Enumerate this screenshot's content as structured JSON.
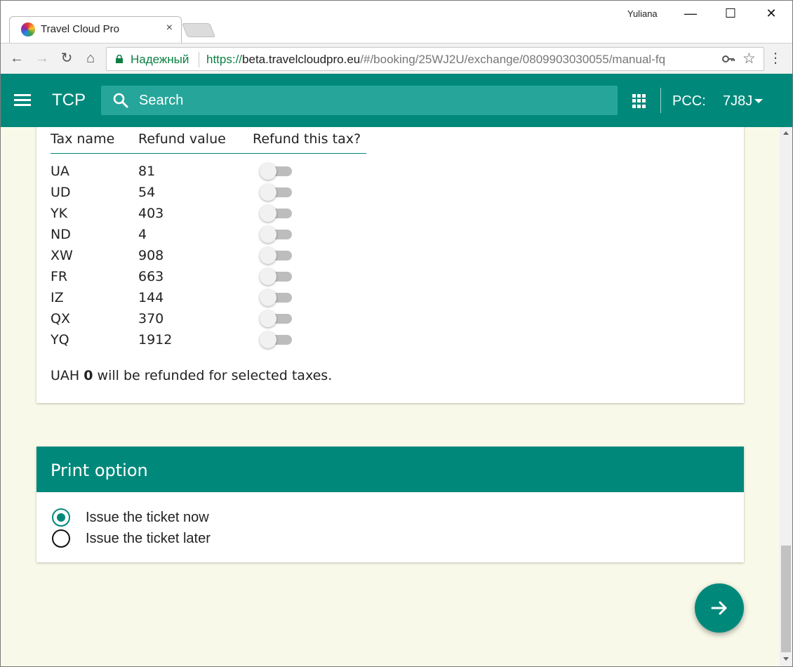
{
  "browser": {
    "tab_title": "Travel Cloud Pro",
    "tab_close": "×",
    "user": "Yuliana",
    "window_controls": {
      "minimize": "—",
      "maximize": "☐",
      "close": "✕"
    },
    "nav": {
      "back": "←",
      "forward": "→",
      "reload": "↻",
      "home": "⌂"
    },
    "secure_label": "Надежный",
    "url_scheme": "https://",
    "url_host": "beta.travelcloudpro.eu",
    "url_path": "/#/booking/25WJ2U/exchange/0809903030055/manual-fq",
    "menu": "⋮"
  },
  "header": {
    "brand": "TCP",
    "search_placeholder": "Search",
    "pcc_label": "PCC:",
    "pcc_value": "7J8J"
  },
  "taxes": {
    "columns": {
      "name": "Tax name",
      "value": "Refund value",
      "refund": "Refund this tax?"
    },
    "rows": [
      {
        "name": "UA",
        "value": "81",
        "refund": false
      },
      {
        "name": "UD",
        "value": "54",
        "refund": false
      },
      {
        "name": "YK",
        "value": "403",
        "refund": false
      },
      {
        "name": "ND",
        "value": "4",
        "refund": false
      },
      {
        "name": "XW",
        "value": "908",
        "refund": false
      },
      {
        "name": "FR",
        "value": "663",
        "refund": false
      },
      {
        "name": "IZ",
        "value": "144",
        "refund": false
      },
      {
        "name": "QX",
        "value": "370",
        "refund": false
      },
      {
        "name": "YQ",
        "value": "1912",
        "refund": false
      }
    ],
    "summary": {
      "currency": "UAH",
      "amount": "0",
      "text": "will be refunded for selected taxes."
    }
  },
  "print_option": {
    "title": "Print option",
    "options": [
      {
        "label": "Issue the ticket now",
        "selected": true
      },
      {
        "label": "Issue the ticket later",
        "selected": false
      }
    ]
  },
  "colors": {
    "primary": "#00897b",
    "search_bg": "#26a69a",
    "page_bg": "#f8f9e8",
    "secure": "#0b8043"
  }
}
